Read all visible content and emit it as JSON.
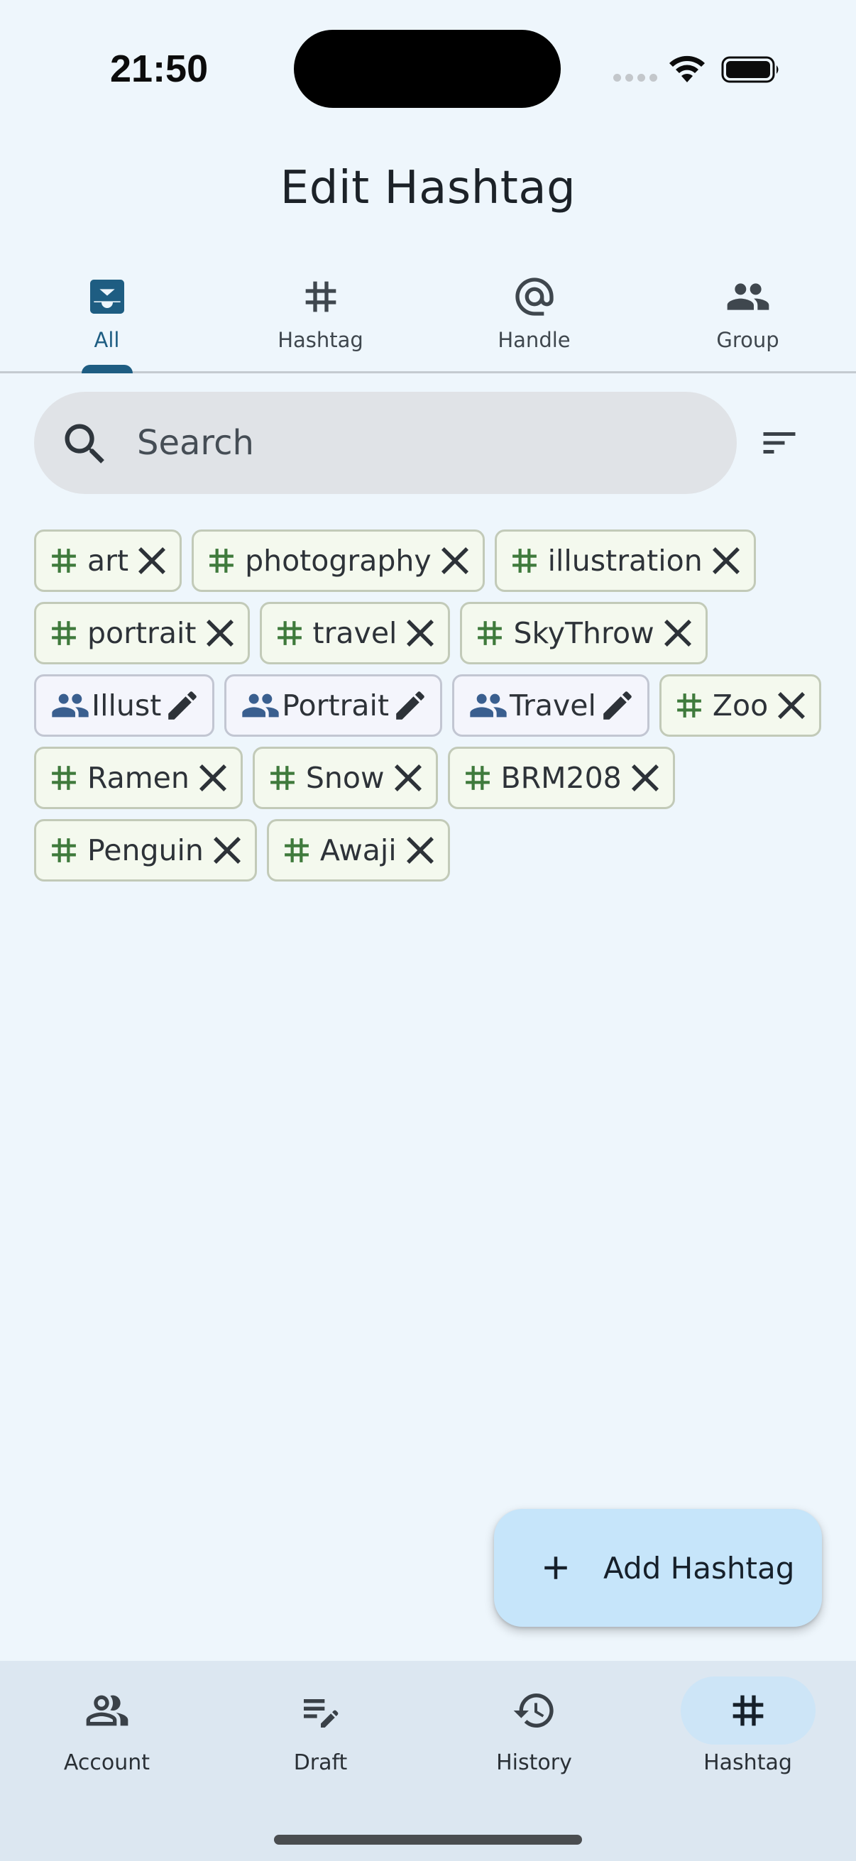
{
  "status_bar": {
    "time": "21:50"
  },
  "title": "Edit Hashtag",
  "tabs": [
    {
      "label": "All",
      "icon": "inbox-icon",
      "active": true
    },
    {
      "label": "Hashtag",
      "icon": "hashtag-icon",
      "active": false
    },
    {
      "label": "Handle",
      "icon": "at-icon",
      "active": false
    },
    {
      "label": "Group",
      "icon": "group-icon",
      "active": false
    }
  ],
  "search": {
    "placeholder": "Search",
    "value": ""
  },
  "chips": [
    {
      "type": "hashtag",
      "label": "art"
    },
    {
      "type": "hashtag",
      "label": "photography"
    },
    {
      "type": "hashtag",
      "label": "illustration"
    },
    {
      "type": "hashtag",
      "label": "portrait"
    },
    {
      "type": "hashtag",
      "label": "travel"
    },
    {
      "type": "hashtag",
      "label": "SkyThrow"
    },
    {
      "type": "group",
      "label": "Illust"
    },
    {
      "type": "group",
      "label": "Portrait"
    },
    {
      "type": "group",
      "label": "Travel"
    },
    {
      "type": "hashtag",
      "label": "Zoo"
    },
    {
      "type": "hashtag",
      "label": "Ramen"
    },
    {
      "type": "hashtag",
      "label": "Snow"
    },
    {
      "type": "hashtag",
      "label": "BRM208"
    },
    {
      "type": "hashtag",
      "label": "Penguin"
    },
    {
      "type": "hashtag",
      "label": "Awaji"
    }
  ],
  "fab": {
    "label": "Add Hashtag",
    "icon": "plus-icon"
  },
  "bottom_nav": [
    {
      "label": "Account",
      "icon": "account-icon",
      "active": false
    },
    {
      "label": "Draft",
      "icon": "draft-icon",
      "active": false
    },
    {
      "label": "History",
      "icon": "history-icon",
      "active": false
    },
    {
      "label": "Hashtag",
      "icon": "hashtag-icon",
      "active": true
    }
  ],
  "colors": {
    "background": "#eef6fc",
    "accent": "#1e5d82",
    "hashtag_green": "#3f7a3c",
    "group_blue": "#3a5f8f",
    "fab": "#c6e5fa"
  }
}
